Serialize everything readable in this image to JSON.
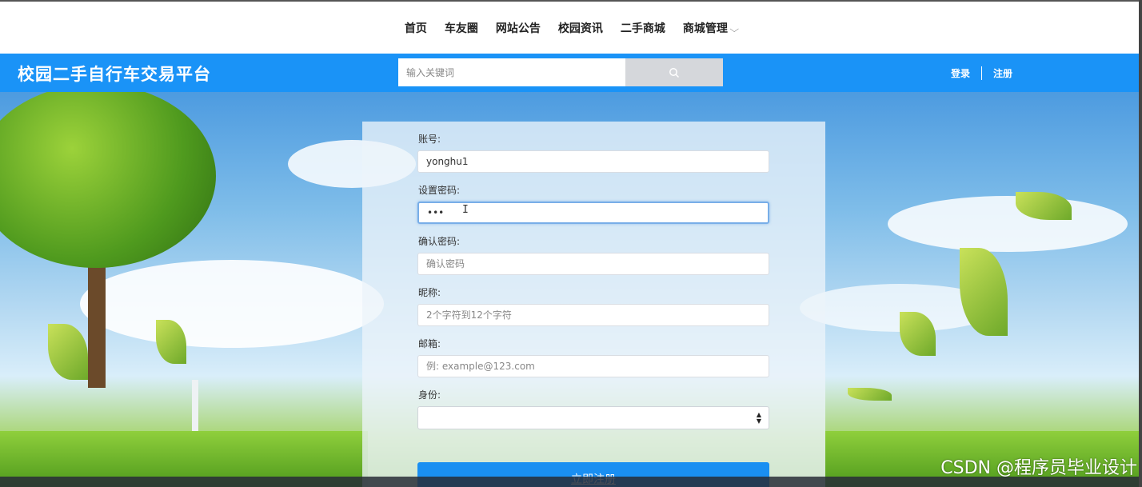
{
  "topnav": {
    "items": [
      "首页",
      "车友圈",
      "网站公告",
      "校园资讯",
      "二手商城",
      "商城管理"
    ]
  },
  "header": {
    "brand": "校园二手自行车交易平台",
    "search_placeholder": "输入关键词",
    "login": "登录",
    "register": "注册"
  },
  "form": {
    "account_label": "账号:",
    "account_value": "yonghu1",
    "password_label": "设置密码:",
    "password_value": "•••",
    "confirm_label": "确认密码:",
    "confirm_placeholder": "确认密码",
    "nickname_label": "昵称:",
    "nickname_placeholder": "2个字符到12个字符",
    "email_label": "邮箱:",
    "email_placeholder": "例: example@123.com",
    "role_label": "身份:",
    "role_value": "",
    "submit": "立即注册"
  },
  "watermark": "CSDN @程序员毕业设计",
  "colors": {
    "header_blue": "#1a93f7",
    "button_blue": "#1a8ff2"
  }
}
